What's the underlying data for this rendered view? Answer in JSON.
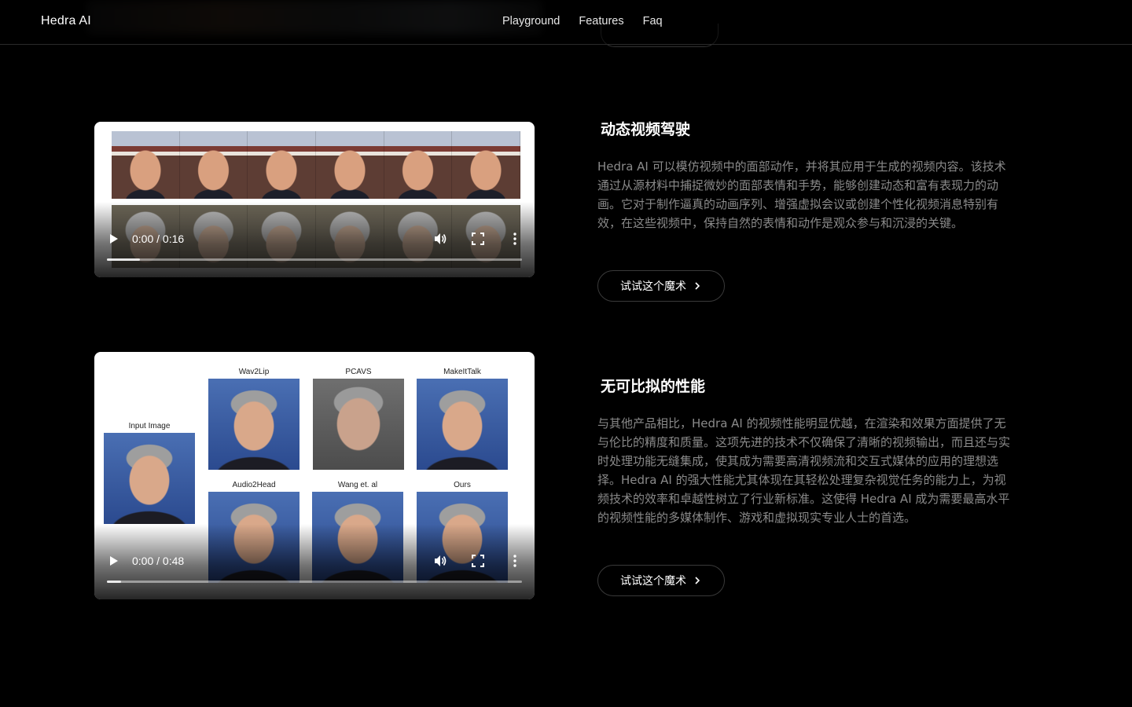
{
  "header": {
    "brand": "Hedra AI",
    "nav": [
      "Playground",
      "Features",
      "Faq"
    ]
  },
  "sections": [
    {
      "title": "动态视频驾驶",
      "description": "Hedra AI 可以模仿视频中的面部动作，并将其应用于生成的视频内容。该技术通过从源材料中捕捉微妙的面部表情和手势，能够创建动态和富有表现力的动画。它对于制作逼真的动画序列、增强虚拟会议或创建个性化视频消息特别有效，在这些视频中，保持自然的表情和动作是观众参与和沉浸的关键。",
      "cta": "试试这个魔术",
      "video": {
        "time": "0:00 / 0:16",
        "progress": 0.08
      }
    },
    {
      "title": "无可比拟的性能",
      "description": "与其他产品相比，Hedra AI 的视频性能明显优越，在渲染和效果方面提供了无与伦比的精度和质量。这项先进的技术不仅确保了清晰的视频输出，而且还与实时处理功能无缝集成，使其成为需要高清视频流和交互式媒体的应用的理想选择。Hedra AI 的强大性能尤其体现在其轻松处理复杂视觉任务的能力上，为视频技术的效率和卓越性树立了行业新标准。这使得 Hedra AI 成为需要最高水平的视频性能的多媒体制作、游戏和虚拟现实专业人士的首选。",
      "cta": "试试这个魔术",
      "video": {
        "time": "0:00 / 0:48",
        "progress": 0.035,
        "labels": [
          "Input Image",
          "Wav2Lip",
          "PCAVS",
          "MakeItTalk",
          "Audio2Head",
          "Wang et. al",
          "Ours"
        ]
      }
    }
  ],
  "colors": {
    "background": "#000000",
    "muted_text": "#8a8a8a",
    "button_border": "#3a3a3a"
  }
}
